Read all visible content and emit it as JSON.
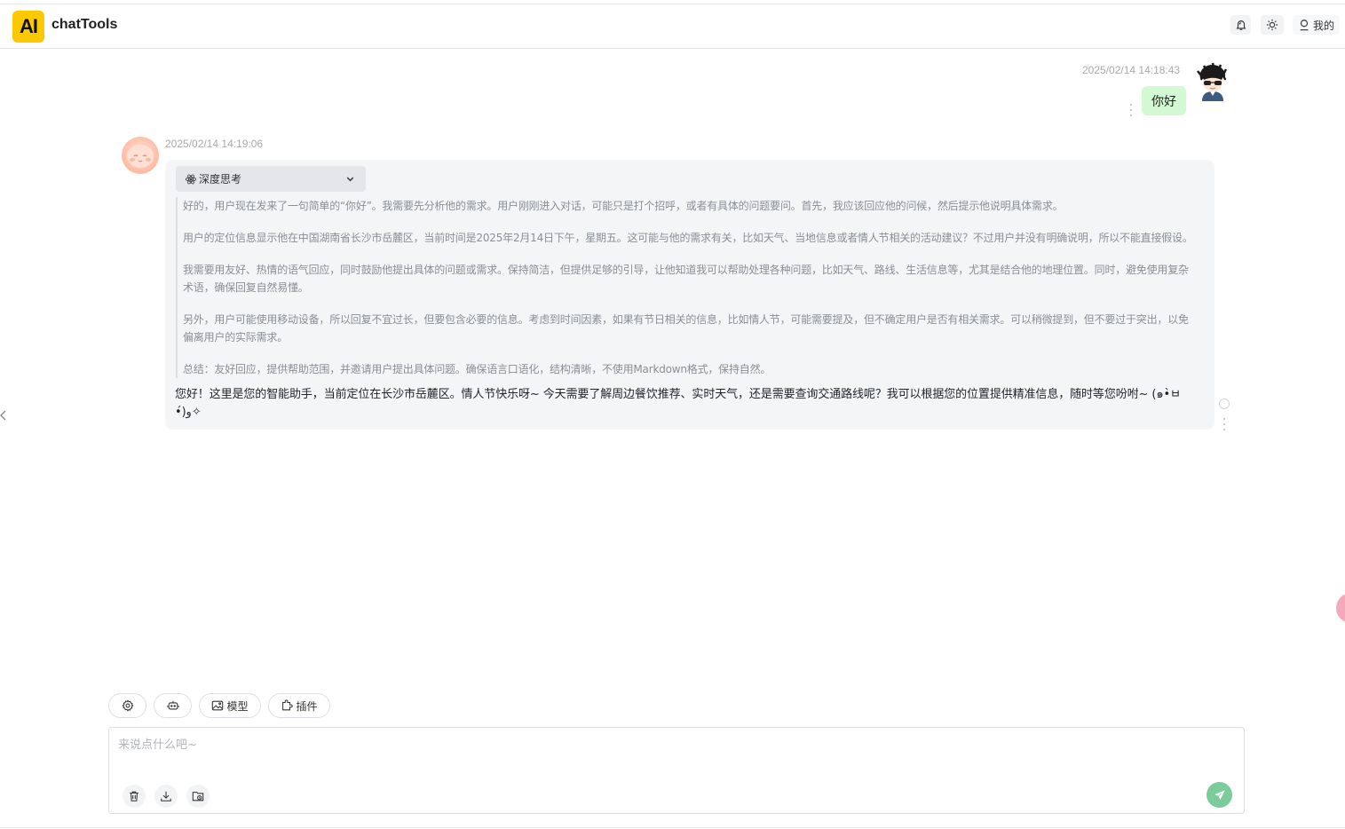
{
  "header": {
    "logo_text": "AI",
    "app_title": "chatTools",
    "user_label": "我的",
    "icons": [
      "bell-icon",
      "sun-icon",
      "user-icon"
    ]
  },
  "messages": [
    {
      "role": "user",
      "time": "2025/02/14 14:18:43",
      "text": "你好"
    },
    {
      "role": "assistant",
      "time": "2025/02/14 14:19:06",
      "think_label": "深度思考",
      "think_paragraphs": [
        "好的，用户现在发来了一句简单的“你好”。我需要先分析他的需求。用户刚刚进入对话，可能只是打个招呼，或者有具体的问题要问。首先，我应该回应他的问候，然后提示他说明具体需求。",
        "用户的定位信息显示他在中国湖南省长沙市岳麓区，当前时间是2025年2月14日下午，星期五。这可能与他的需求有关，比如天气、当地信息或者情人节相关的活动建议？不过用户并没有明确说明，所以不能直接假设。",
        "我需要用友好、热情的语气回应，同时鼓励他提出具体的问题或需求。保持简洁，但提供足够的引导，让他知道我可以帮助处理各种问题，比如天气、路线、生活信息等，尤其是结合他的地理位置。同时，避免使用复杂术语，确保回复自然易懂。",
        "另外，用户可能使用移动设备，所以回复不宜过长，但要包含必要的信息。考虑到时间因素，如果有节日相关的信息，比如情人节，可能需要提及，但不确定用户是否有相关需求。可以稍微提到，但不要过于突出，以免偏离用户的实际需求。",
        "总结：友好回应，提供帮助范围，并邀请用户提出具体问题。确保语言口语化，结构清晰，不使用Markdown格式，保持自然。"
      ],
      "answer": "您好！这里是您的智能助手，当前定位在长沙市岳麓区。情人节快乐呀~ 今天需要了解周边餐饮推荐、实时天气，还是需要查询交通路线呢？我可以根据您的位置提供精准信息，随时等您吩咐~ (๑•̀ㅂ•́)و✧"
    }
  ],
  "toolbar": {
    "model_label": "模型",
    "plugin_label": "插件"
  },
  "input": {
    "placeholder": "来说点什么吧~",
    "value": ""
  },
  "colors": {
    "logo_bg": "#fcc900",
    "user_bubble": "#d2f9d1",
    "ai_card": "#f4f5f7",
    "send_button": "#7ccb9a"
  }
}
